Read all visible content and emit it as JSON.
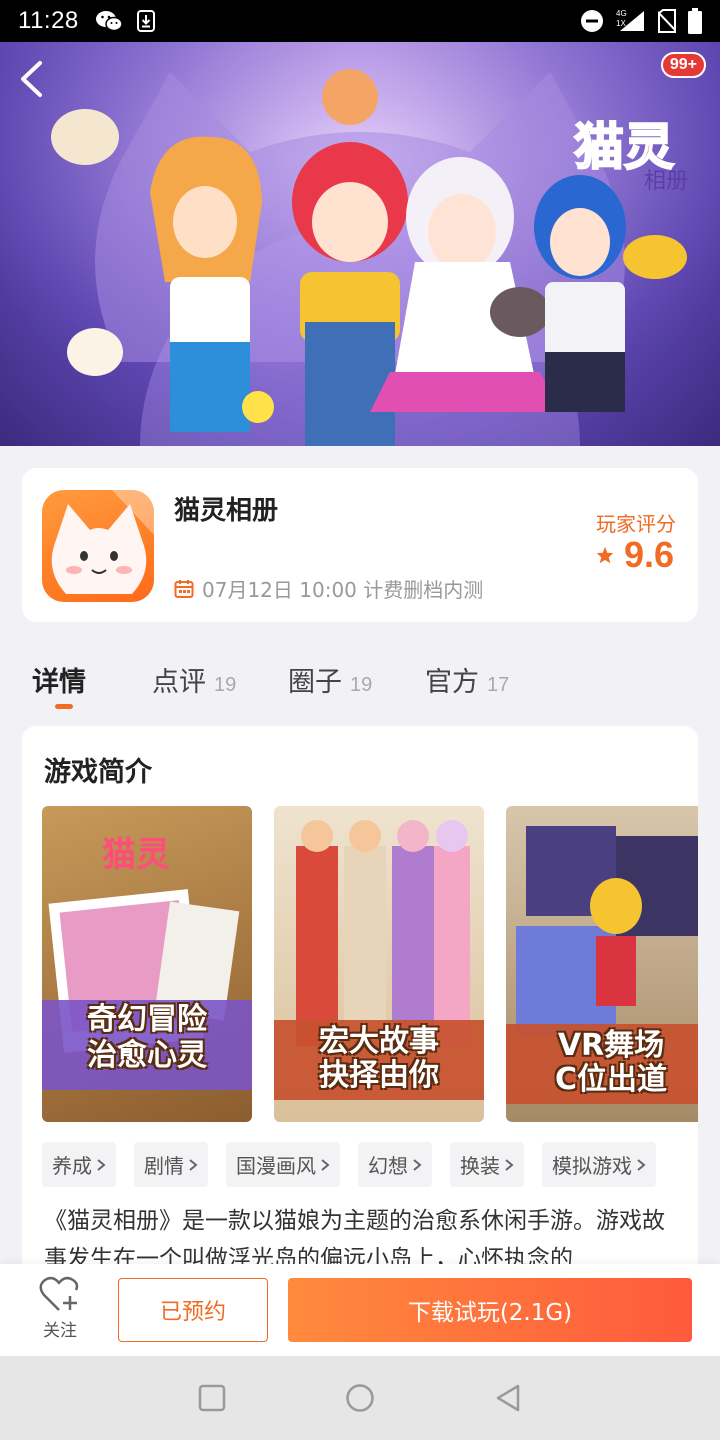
{
  "status_bar": {
    "time": "11:28",
    "network_label": "4G",
    "sim_label": "1X",
    "icons": [
      "wechat-icon",
      "download-icon",
      "dnd-icon",
      "signal-icon",
      "no-sim-icon",
      "battery-icon"
    ]
  },
  "hero": {
    "notification_badge": "99+",
    "logo_text_main": "猫灵",
    "logo_text_sub": "相册"
  },
  "game": {
    "title": "猫灵相册",
    "test_info": "07月12日 10:00 计费删档内测",
    "rating_label": "玩家评分",
    "rating_value": "9.6"
  },
  "tabs": [
    {
      "label": "详情",
      "count": ""
    },
    {
      "label": "点评",
      "count": "19"
    },
    {
      "label": "圈子",
      "count": "19"
    },
    {
      "label": "官方",
      "count": "17"
    }
  ],
  "detail": {
    "section_title": "游戏简介",
    "screenshots": [
      {
        "caption_line1": "奇幻冒险",
        "caption_line2": "治愈心灵"
      },
      {
        "caption_line1": "宏大故事",
        "caption_line2": "抉择由你"
      },
      {
        "caption_line1": "VR舞场",
        "caption_line2": "C位出道"
      }
    ],
    "tags": [
      "养成",
      "剧情",
      "国漫画风",
      "幻想",
      "换装",
      "模拟游戏"
    ],
    "description": "《猫灵相册》是一款以猫娘为主题的治愈系休闲手游。游戏故事发生在一个叫做浮光岛的偏远小岛上，心怀执念的"
  },
  "bottom_bar": {
    "follow_label": "关注",
    "reserved_label": "已预约",
    "download_label": "下载试玩(2.1G)"
  },
  "colors": {
    "accent": "#f26b22",
    "download_start": "#ff8a3d",
    "download_end": "#ff5a3c",
    "page_bg": "#f2f2f6"
  }
}
